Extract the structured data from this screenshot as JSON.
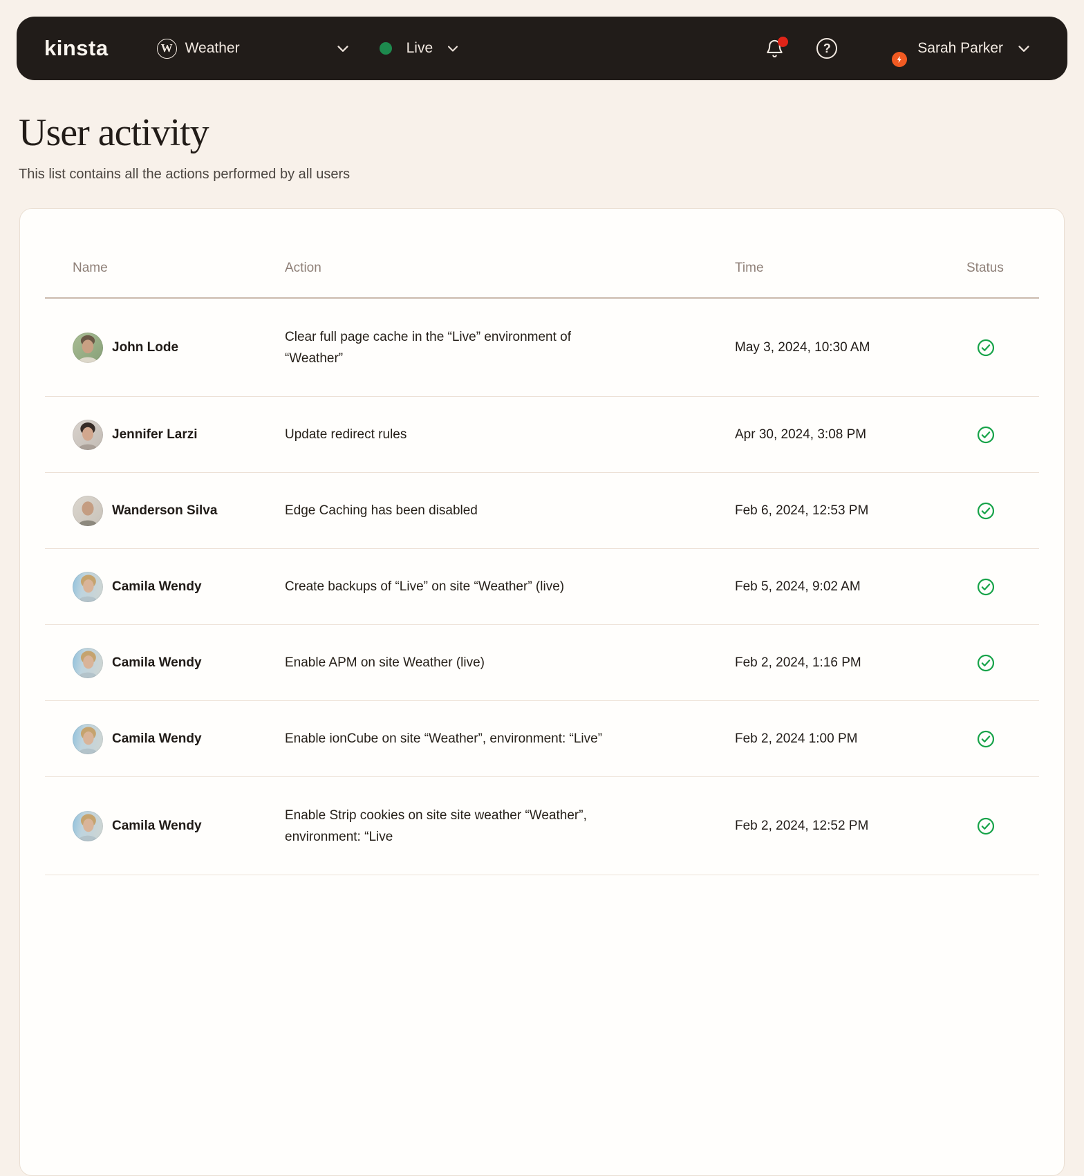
{
  "navbar": {
    "logo": "kinsta",
    "site_selector": {
      "label": "Weather"
    },
    "env_selector": {
      "label": "Live",
      "status_color": "#1d8a4e"
    },
    "notifications": {
      "has_unread": true,
      "dot_color": "#e02418"
    },
    "user": {
      "name": "Sarah Parker",
      "avatar": "sarah-parker",
      "badge_color": "#f15a22"
    }
  },
  "page": {
    "title": "User activity",
    "subtitle": "This list contains all the actions performed by all users"
  },
  "table": {
    "columns": [
      "Name",
      "Action",
      "Time",
      "Status"
    ],
    "rows": [
      {
        "name": "John Lode",
        "avatar": "john-lode",
        "action": "Clear full page cache in the “Live” environment of\n“Weather”",
        "time": "May 3, 2024, 10:30 AM",
        "status": "success"
      },
      {
        "name": "Jennifer Larzi",
        "avatar": "jennifer-larzi",
        "action": "Update redirect rules",
        "time": "Apr 30, 2024, 3:08 PM",
        "status": "success"
      },
      {
        "name": "Wanderson Silva",
        "avatar": "wanderson-silva",
        "action": "Edge Caching has been disabled",
        "time": "Feb 6, 2024, 12:53 PM",
        "status": "success"
      },
      {
        "name": "Camila Wendy",
        "avatar": "camila-wendy",
        "action": "Create backups of “Live” on site “Weather” (live)",
        "time": "Feb 5, 2024, 9:02 AM",
        "status": "success"
      },
      {
        "name": "Camila Wendy",
        "avatar": "camila-wendy",
        "action": "Enable APM on site Weather (live)",
        "time": "Feb 2, 2024, 1:16 PM",
        "status": "success"
      },
      {
        "name": "Camila Wendy",
        "avatar": "camila-wendy",
        "action": "Enable ionCube on site “Weather”, environment: “Live”",
        "time": "Feb 2, 2024 1:00 PM",
        "status": "success"
      },
      {
        "name": "Camila Wendy",
        "avatar": "camila-wendy",
        "action": "Enable Strip cookies on site site weather “Weather”,\nenvironment: “Live",
        "time": "Feb 2, 2024, 12:52 PM",
        "status": "success"
      }
    ]
  },
  "icons": {
    "wordpress_icon": "W",
    "help_icon": "?",
    "status_success_icon": "check-circle",
    "success_color": "#17a349"
  }
}
